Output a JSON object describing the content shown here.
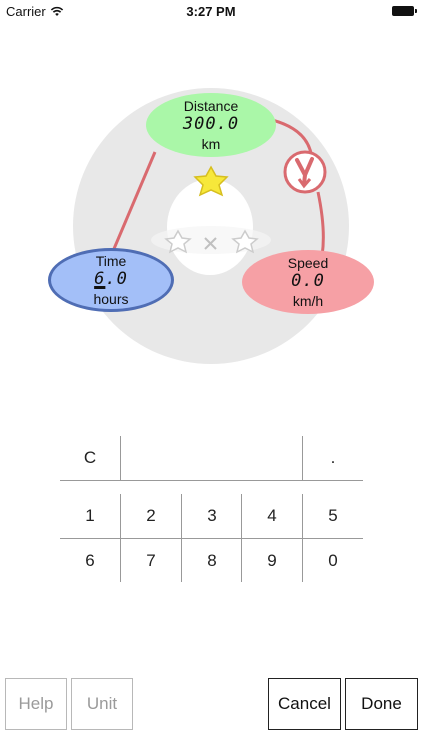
{
  "status_bar": {
    "carrier": "Carrier",
    "time": "3:27 PM"
  },
  "dial": {
    "distance": {
      "label": "Distance",
      "value": "300.0",
      "unit": "km"
    },
    "time": {
      "label": "Time",
      "value_first": "6",
      "value_rest": ".0",
      "unit": "hours"
    },
    "speed": {
      "label": "Speed",
      "value": "0.0",
      "unit": "km/h"
    }
  },
  "keypad": {
    "clear": "C",
    "decimal": ".",
    "row1": [
      "1",
      "2",
      "3",
      "4",
      "5"
    ],
    "row2": [
      "6",
      "7",
      "8",
      "9",
      "0"
    ]
  },
  "footer": {
    "help": "Help",
    "unit": "Unit",
    "cancel": "Cancel",
    "done": "Done"
  },
  "colors": {
    "distance": "#aaf7a8",
    "time": "#a3bff8",
    "time_border": "#4f6db4",
    "speed": "#f6a0a5",
    "connector": "#d96a6f",
    "star_active": "#f7e83a"
  }
}
